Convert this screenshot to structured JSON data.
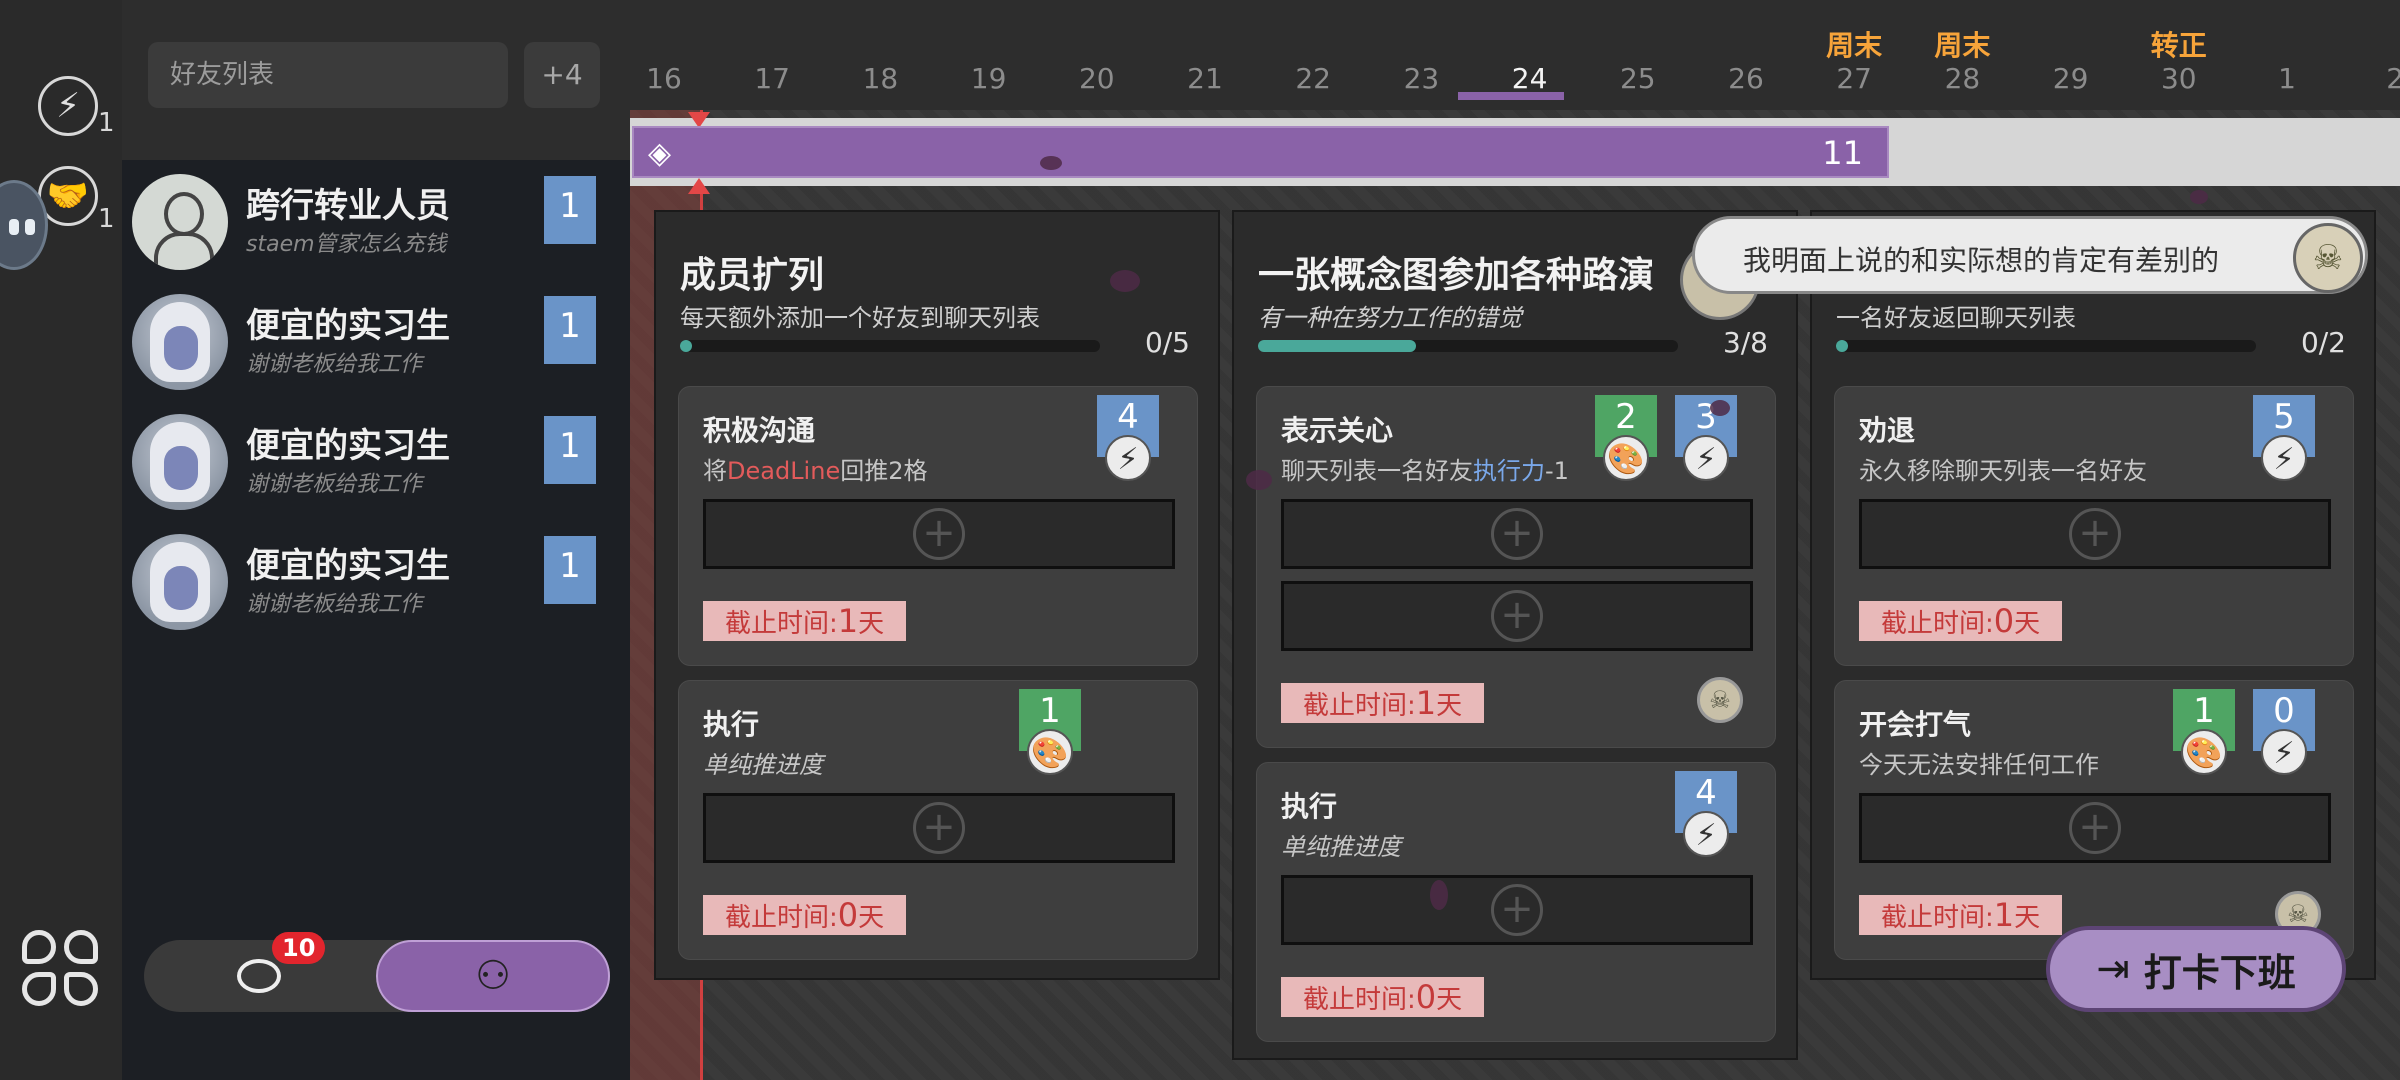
{
  "rail": {
    "energy_count": "1",
    "handshake_count": "1"
  },
  "friends": {
    "search_placeholder": "好友列表",
    "more_label": "+4",
    "items": [
      {
        "name": "跨行转业人员",
        "subtitle": "staem管家怎么充钱",
        "badge": "1",
        "avatar": "generic-avatar"
      },
      {
        "name": "便宜的实习生",
        "subtitle": "谢谢老板给我工作",
        "badge": "1",
        "avatar": "intern-avatar"
      },
      {
        "name": "便宜的实习生",
        "subtitle": "谢谢老板给我工作",
        "badge": "1",
        "avatar": "intern-avatar"
      },
      {
        "name": "便宜的实习生",
        "subtitle": "谢谢老板给我工作",
        "badge": "1",
        "avatar": "intern-avatar"
      }
    ],
    "chat_badge": "10"
  },
  "calendar": {
    "days": [
      "16",
      "17",
      "18",
      "19",
      "20",
      "21",
      "22",
      "23",
      "24",
      "25",
      "26",
      "27",
      "28",
      "29",
      "30",
      "1",
      "2"
    ],
    "active_day": "24",
    "tags": {
      "27": "周末",
      "28": "周末",
      "30": "转正"
    }
  },
  "deadline_track": {
    "count": "11",
    "progress_fraction": 0.71
  },
  "columns": [
    {
      "title": "成员扩列",
      "desc": "每天额外添加一个好友到聊天列表",
      "ratio": "0/5",
      "progress": 0.0,
      "tasks": [
        {
          "title": "积极沟通",
          "desc_pre": "将",
          "desc_red": "DeadLine",
          "desc_post": "回推2格",
          "req_blue": "4",
          "deadline_label": "截止时间:",
          "deadline_value": "1",
          "deadline_unit": "天"
        },
        {
          "title": "执行",
          "desc": "单纯推进度",
          "req_green": "1",
          "deadline_label": "截止时间:",
          "deadline_value": "0",
          "deadline_unit": "天"
        }
      ]
    },
    {
      "title": "一张概念图参加各种路演",
      "desc": "有一种在努力工作的错觉",
      "ratio": "3/8",
      "progress": 0.375,
      "tasks": [
        {
          "title": "表示关心",
          "desc_pre": "聊天列表一名好友",
          "desc_blue": "执行力",
          "desc_post": "-1",
          "req_green": "2",
          "req_blue": "3",
          "deadline_label": "截止时间:",
          "deadline_value": "1",
          "deadline_unit": "天"
        },
        {
          "title": "执行",
          "desc": "单纯推进度",
          "req_blue": "4",
          "deadline_label": "截止时间:",
          "deadline_value": "0",
          "deadline_unit": "天"
        }
      ]
    },
    {
      "title": "",
      "desc": "一名好友返回聊天列表",
      "ratio": "0/2",
      "progress": 0.0,
      "tasks": [
        {
          "title": "劝退",
          "desc": "永久移除聊天列表一名好友",
          "req_blue": "5",
          "deadline_label": "截止时间:",
          "deadline_value": "0",
          "deadline_unit": "天"
        },
        {
          "title": "开会打气",
          "desc": "今天无法安排任何工作",
          "req_green": "1",
          "req_blue": "0",
          "deadline_label": "截止时间:",
          "deadline_value": "1",
          "deadline_unit": "天"
        }
      ]
    }
  ],
  "speech": {
    "text": "我明面上说的和实际想的肯定有差别的"
  },
  "clockout": {
    "label": "打卡下班"
  },
  "colors": {
    "accent_purple": "#8a62a8",
    "badge_blue": "#6a94c8",
    "badge_green": "#4fa564",
    "deadline_red": "#c43a3a",
    "weekend_orange": "#f7a43a"
  }
}
